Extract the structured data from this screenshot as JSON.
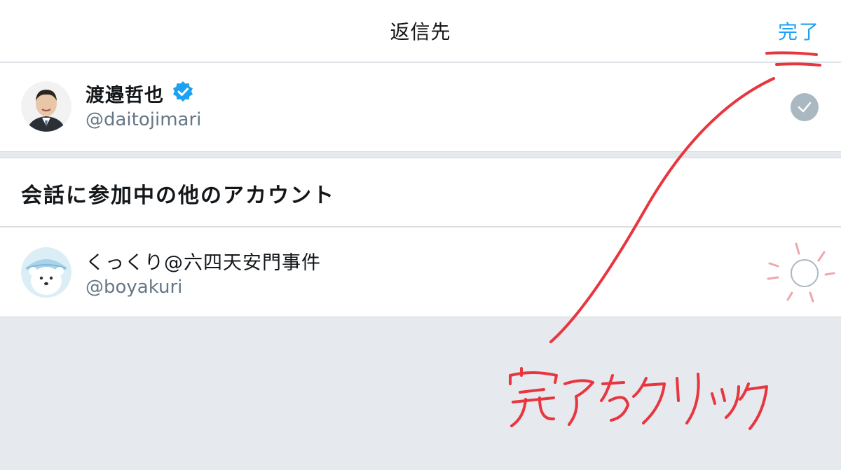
{
  "header": {
    "title": "返信先",
    "done_label": "完了"
  },
  "selected_account": {
    "name": "渡邉哲也",
    "handle": "@daitojimari",
    "verified": true,
    "checked": true
  },
  "section": {
    "title": "会話に参加中の他のアカウント"
  },
  "other_accounts": [
    {
      "name": "くっくり@六四天安門事件",
      "handle": "@boyakuri",
      "checked": false
    }
  ],
  "annotation": {
    "text": "完了をクリック",
    "color": "#e8363f"
  },
  "colors": {
    "accent": "#1da1f2",
    "muted": "#657786",
    "check_gray": "#aab8c2",
    "background": "#e6e9ee"
  }
}
